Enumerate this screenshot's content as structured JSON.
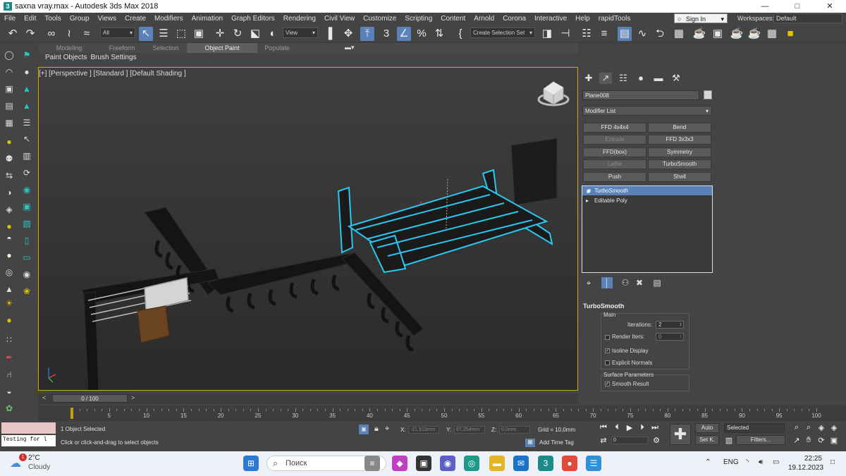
{
  "window": {
    "title": "saxna vray.max - Autodesk 3ds Max 2018",
    "controls": [
      "—",
      "□",
      "✕"
    ]
  },
  "menu": [
    "File",
    "Edit",
    "Tools",
    "Group",
    "Views",
    "Create",
    "Modifiers",
    "Animation",
    "Graph Editors",
    "Rendering",
    "Civil View",
    "Customize",
    "Scripting",
    "Content",
    "Arnold",
    "Corona",
    "Interactive",
    "Help",
    "rapidTools"
  ],
  "account": {
    "sign_in": "Sign In",
    "workspaces_label": "Workspaces:",
    "workspace": "Default"
  },
  "toolbar": {
    "filter": "All",
    "ref_coord": "View",
    "selection_set": "Create Selection Set"
  },
  "ribbon": {
    "tabs": [
      "Modeling",
      "Freeform",
      "Selection",
      "Object Paint",
      "Populate"
    ],
    "active_tab": "Object Paint",
    "sub_items": [
      "Paint Objects",
      "Brush Settings"
    ]
  },
  "viewport": {
    "label": "[+] [Perspective ] [Standard ] [Default Shading ]"
  },
  "command_panel": {
    "object_name": "Plane008",
    "object_color": "#d8d8d8",
    "modifier_list": "Modifier List",
    "modifier_buttons": [
      "FFD 4x4x4",
      "Bend",
      "Extrude",
      "FFD 3x3x3",
      "FFD(box)",
      "Symmetry",
      "Lathe",
      "TurboSmooth",
      "Push",
      "Shell"
    ],
    "stack": [
      {
        "prefix": "◉",
        "label": "TurboSmooth",
        "selected": true
      },
      {
        "prefix": "▸",
        "label": "Editable Poly",
        "selected": false
      }
    ],
    "rollout": {
      "title": "TurboSmooth",
      "main_group": "Main",
      "iterations_label": "Iterations:",
      "iterations": "2",
      "render_iters_label": "Render Iters:",
      "render_iters": "0",
      "isoline_display": "Isoline Display",
      "explicit_normals": "Explicit Normals",
      "surface_group": "Surface Parameters",
      "smooth_result": "Smooth Result"
    }
  },
  "timeline": {
    "position": "0 / 100",
    "ticks": [
      "5",
      "10",
      "15",
      "20",
      "25",
      "30",
      "35",
      "40",
      "45",
      "50",
      "55",
      "60",
      "65",
      "70",
      "75",
      "80",
      "85",
      "90",
      "95",
      "100"
    ]
  },
  "status": {
    "maxscript_top": "",
    "maxscript_bottom": "Testing for l",
    "selection": "1 Object Selected",
    "prompt": "Click or click-and-drag to select objects",
    "x_label": "X:",
    "x_value": "-21,913mm",
    "y_label": "Y:",
    "y_value": "67,254mm",
    "z_label": "Z:",
    "z_value": "0,0mm",
    "grid": "Grid = 10,0mm",
    "add_time_tag": "Add Time Tag",
    "auto_key": "Auto",
    "set_key": "Set K.",
    "key_filter_select": "Selected",
    "filters": "Filters...",
    "frame": "0"
  },
  "taskbar": {
    "temperature": "2°C",
    "weather": "Cloudy",
    "notification_count": "1",
    "search_placeholder": "Поиск",
    "language": "ENG",
    "time": "22:25",
    "date": "19.12.2023"
  },
  "colors": {
    "accent": "#5b82b8",
    "selection_outline": "#29c8f0",
    "viewport_border": "#c8b000"
  }
}
